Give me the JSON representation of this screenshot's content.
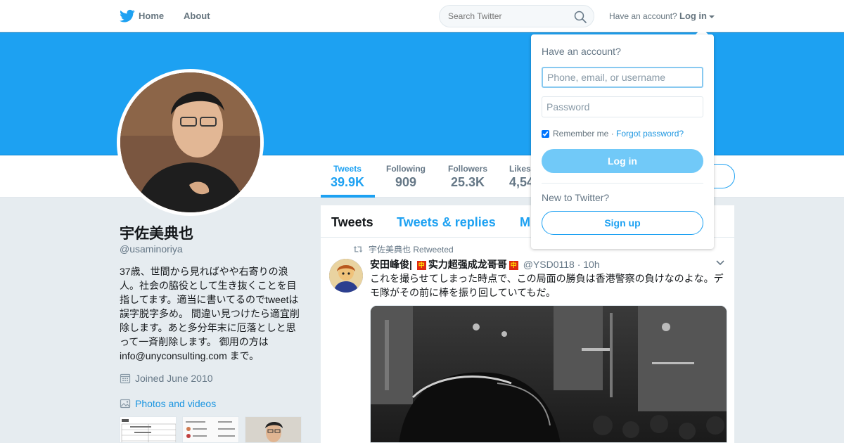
{
  "nav": {
    "home_label": "Home",
    "about_label": "About",
    "search_placeholder": "Search Twitter",
    "have_account": "Have an account?",
    "login_label": "Log in",
    "logo_icon": "twitter-bird-icon",
    "brand_color": "#1da1f2"
  },
  "profile": {
    "name": "宇佐美典也",
    "handle": "@usaminoriya",
    "bio_text": "37歳、世間から見ればやや右寄りの浪人。社会の脇役として生き抜くことを目指してます。適当に書いてるのでtweetは誤字脱字多め。 間違い見つけたら適宜削除します。あと多分年末に厄落としと思って一斉削除します。 御用の方は info@unyconsulting.com まで。",
    "joined": "Joined June 2010",
    "photos_link": "Photos and videos"
  },
  "stats": [
    {
      "label": "Tweets",
      "value": "39.9K"
    },
    {
      "label": "Following",
      "value": "909"
    },
    {
      "label": "Followers",
      "value": "25.3K"
    },
    {
      "label": "Likes",
      "value": "4,54"
    }
  ],
  "timeline": {
    "tabs": [
      "Tweets",
      "Tweets & replies",
      "M"
    ],
    "tweet": {
      "retweet_context": "宇佐美典也 Retweeted",
      "author_part1": "安田峰俊|",
      "flag_glyph": "中",
      "author_part2": "实力超强成龙哥哥",
      "handle": "@YSD0118",
      "separator": "·",
      "time": "10h",
      "text": "これを撮らせてしまった時点で、この局面の勝負は香港警察の負けなのよな。デモ隊がその前に棒を振り回していてもだ。"
    }
  },
  "login_dropdown": {
    "title": "Have an account?",
    "username_placeholder": "Phone, email, or username",
    "password_placeholder": "Password",
    "remember_me": "Remember me",
    "separator": "·",
    "forgot_password": "Forgot password?",
    "login_button": "Log in",
    "new_to_twitter": "New to Twitter?",
    "signup_button": "Sign up",
    "remember_checked": true
  }
}
